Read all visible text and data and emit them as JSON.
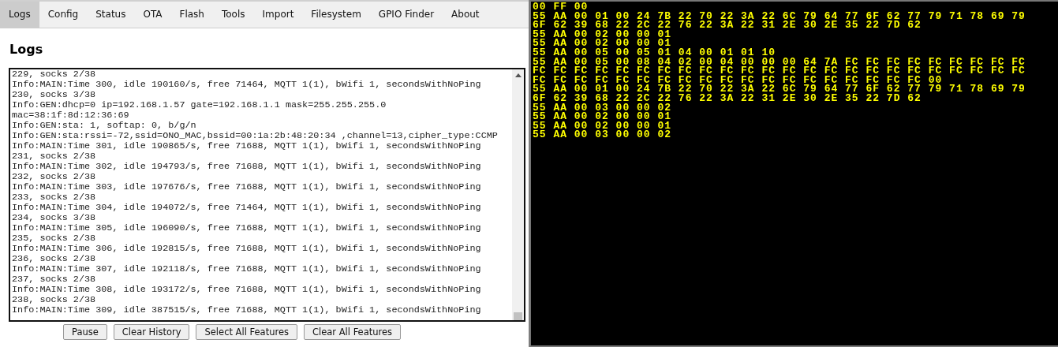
{
  "tabs": [
    {
      "label": "Logs",
      "selected": true
    },
    {
      "label": "Config",
      "selected": false
    },
    {
      "label": "Status",
      "selected": false
    },
    {
      "label": "OTA",
      "selected": false
    },
    {
      "label": "Flash",
      "selected": false
    },
    {
      "label": "Tools",
      "selected": false
    },
    {
      "label": "Import",
      "selected": false
    },
    {
      "label": "Filesystem",
      "selected": false
    },
    {
      "label": "GPIO Finder",
      "selected": false
    },
    {
      "label": "About",
      "selected": false
    }
  ],
  "heading": "Logs",
  "log_lines": [
    "229, socks 2/38",
    "Info:MAIN:Time 300, idle 190160/s, free 71464, MQTT 1(1), bWifi 1, secondsWithNoPing",
    "230, socks 3/38",
    "Info:GEN:dhcp=0 ip=192.168.1.57 gate=192.168.1.1 mask=255.255.255.0",
    "mac=38:1f:8d:12:36:69",
    "Info:GEN:sta: 1, softap: 0, b/g/n",
    "Info:GEN:sta:rssi=-72,ssid=ONO_MAC,bssid=00:1a:2b:48:20:34 ,channel=13,cipher_type:CCMP",
    "Info:MAIN:Time 301, idle 190865/s, free 71688, MQTT 1(1), bWifi 1, secondsWithNoPing",
    "231, socks 2/38",
    "Info:MAIN:Time 302, idle 194793/s, free 71688, MQTT 1(1), bWifi 1, secondsWithNoPing",
    "232, socks 2/38",
    "Info:MAIN:Time 303, idle 197676/s, free 71688, MQTT 1(1), bWifi 1, secondsWithNoPing",
    "233, socks 2/38",
    "Info:MAIN:Time 304, idle 194072/s, free 71464, MQTT 1(1), bWifi 1, secondsWithNoPing",
    "234, socks 3/38",
    "Info:MAIN:Time 305, idle 196090/s, free 71688, MQTT 1(1), bWifi 1, secondsWithNoPing",
    "235, socks 2/38",
    "Info:MAIN:Time 306, idle 192815/s, free 71688, MQTT 1(1), bWifi 1, secondsWithNoPing",
    "236, socks 2/38",
    "Info:MAIN:Time 307, idle 192118/s, free 71688, MQTT 1(1), bWifi 1, secondsWithNoPing",
    "237, socks 2/38",
    "Info:MAIN:Time 308, idle 193172/s, free 71688, MQTT 1(1), bWifi 1, secondsWithNoPing",
    "238, socks 2/38",
    "Info:MAIN:Time 309, idle 387515/s, free 71688, MQTT 1(1), bWifi 1, secondsWithNoPing"
  ],
  "buttons": [
    "Pause",
    "Clear History",
    "Select All Features",
    "Clear All Features"
  ],
  "terminal_lines": [
    "00 FF 00",
    "55 AA 00 01 00 24 7B 22 70 22 3A 22 6C 79 64 77 6F 62 77 79 71 78 69 79",
    "6F 62 39 68 22 2C 22 76 22 3A 22 31 2E 30 2E 35 22 7D 62",
    "55 AA 00 02 00 00 01",
    "55 AA 00 02 00 00 01",
    "55 AA 00 05 00 05 01 04 00 01 01 10",
    "55 AA 00 05 00 08 04 02 00 04 00 00 00 64 7A FC FC FC FC FC FC FC FC FC",
    "FC FC FC FC FC FC FC FC FC FC FC FC FC FC FC FC FC FC FC FC FC FC FC FC",
    "FC FC FC FC FC FC FC FC FC FC FC FC FC FC FC FC FC FC FC 00",
    "55 AA 00 01 00 24 7B 22 70 22 3A 22 6C 79 64 77 6F 62 77 79 71 78 69 79",
    "6F 62 39 68 22 2C 22 76 22 3A 22 31 2E 30 2E 35 22 7D 62",
    "55 AA 00 03 00 00 02",
    "55 AA 00 02 00 00 01",
    "55 AA 00 02 00 00 01",
    "55 AA 00 03 00 00 02"
  ]
}
